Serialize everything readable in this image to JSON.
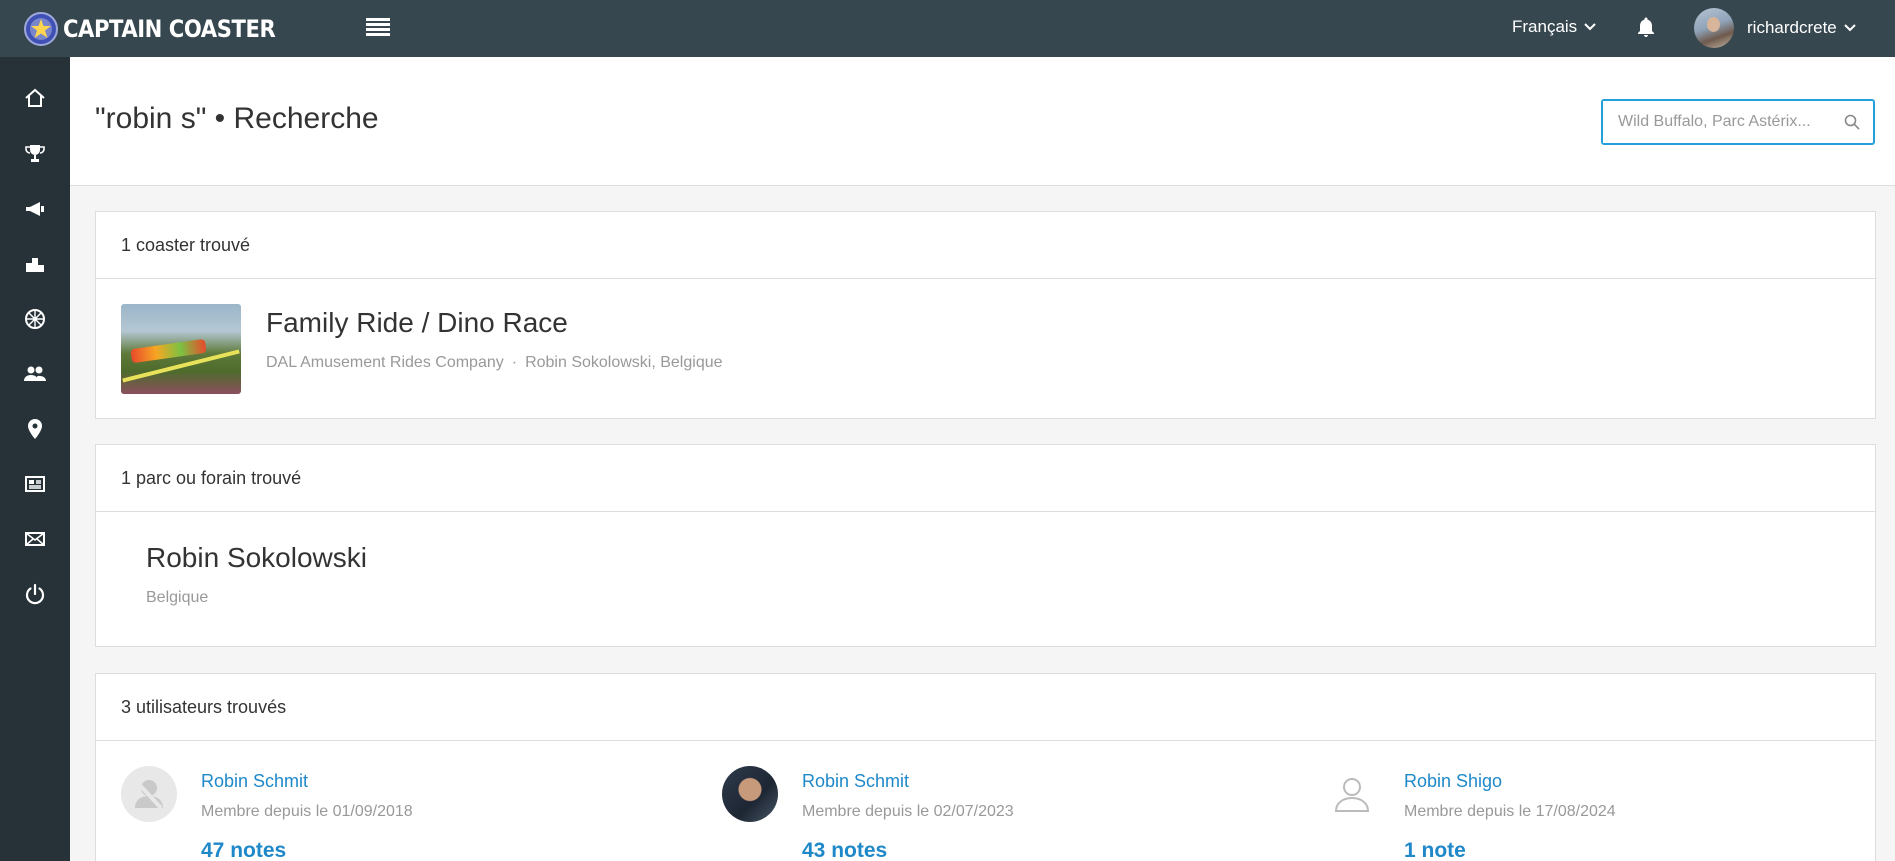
{
  "brand": {
    "name": "CAPTAIN COASTER"
  },
  "header": {
    "language": "Français",
    "username": "richardcrete"
  },
  "sidebar": {
    "items": [
      {
        "icon": "home-icon"
      },
      {
        "icon": "trophy-icon"
      },
      {
        "icon": "megaphone-icon"
      },
      {
        "icon": "podium-icon"
      },
      {
        "icon": "wheel-icon"
      },
      {
        "icon": "users-icon"
      },
      {
        "icon": "location-icon"
      },
      {
        "icon": "newspaper-icon"
      },
      {
        "icon": "envelope-icon"
      },
      {
        "icon": "power-icon"
      }
    ]
  },
  "page": {
    "title": "\"robin s\" • Recherche",
    "search_placeholder": "Wild Buffalo, Parc Astérix..."
  },
  "coasters": {
    "heading": "1 coaster trouvé",
    "items": [
      {
        "name": "Family Ride / Dino Race",
        "manufacturer": "DAL Amusement Rides Company",
        "separator": "·",
        "location": "Robin Sokolowski, Belgique"
      }
    ]
  },
  "parks": {
    "heading": "1 parc ou forain trouvé",
    "items": [
      {
        "name": "Robin Sokolowski",
        "country": "Belgique"
      }
    ]
  },
  "users": {
    "heading": "3 utilisateurs trouvés",
    "items": [
      {
        "name": "Robin Schmit",
        "since": "Membre depuis le 01/09/2018",
        "notes": "47 notes"
      },
      {
        "name": "Robin Schmit",
        "since": "Membre depuis le 02/07/2023",
        "notes": "43 notes"
      },
      {
        "name": "Robin Shigo",
        "since": "Membre depuis le 17/08/2024",
        "notes": "1 note"
      }
    ]
  },
  "colors": {
    "topbar": "#37474f",
    "sidebar": "#263238",
    "link": "#1e88c9",
    "search_border": "#26a0da"
  }
}
